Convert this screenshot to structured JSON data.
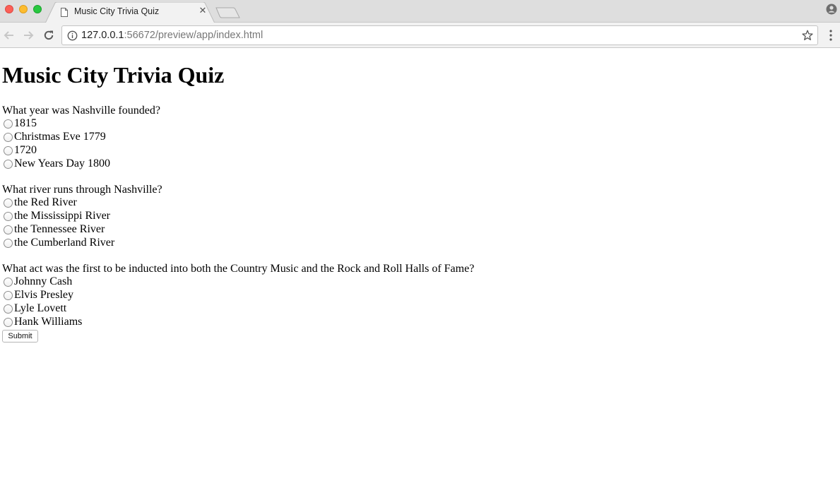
{
  "browser": {
    "tab_title": "Music City Trivia Quiz",
    "url_host": "127.0.0.1",
    "url_path": ":56672/preview/app/index.html"
  },
  "page": {
    "title": "Music City Trivia Quiz",
    "questions": [
      {
        "text": "What year was Nashville founded?",
        "options": [
          "1815",
          "Christmas Eve 1779",
          "1720",
          "New Years Day 1800"
        ]
      },
      {
        "text": "What river runs through Nashville?",
        "options": [
          "the Red River",
          "the Mississippi River",
          "the Tennessee River",
          "the Cumberland River"
        ]
      },
      {
        "text": "What act was the first to be inducted into both the Country Music and the Rock and Roll Halls of Fame?",
        "options": [
          "Johnny Cash",
          "Elvis Presley",
          "Lyle Lovett",
          "Hank Williams"
        ]
      }
    ],
    "submit_label": "Submit"
  },
  "colors": {
    "close_red": "#fc5f57",
    "minimize_yellow": "#fdbc2e",
    "zoom_green": "#28c840"
  },
  "icons": [
    "page-icon",
    "close-icon",
    "new-tab-icon",
    "profile-icon",
    "back-icon",
    "forward-icon",
    "reload-icon",
    "info-icon",
    "star-icon",
    "menu-icon"
  ]
}
